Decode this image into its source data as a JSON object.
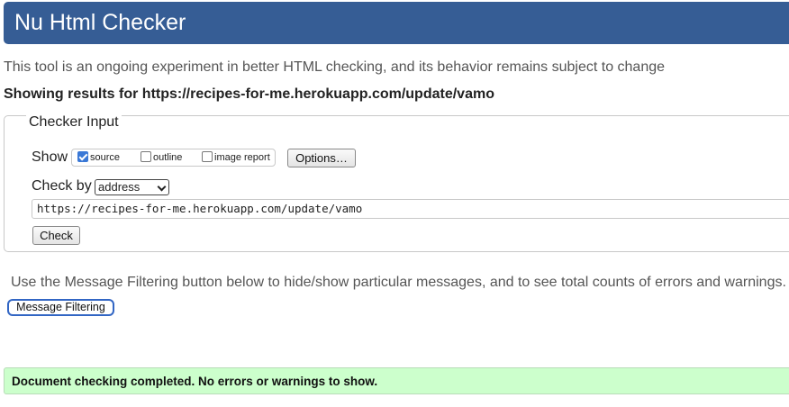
{
  "header": {
    "title": "Nu Html Checker",
    "bg_color": "#365d95"
  },
  "intro_text": "This tool is an ongoing experiment in better HTML checking, and its behavior remains subject to change",
  "results_heading": "Showing results for https://recipes-for-me.herokuapp.com/update/vamo",
  "checker_input": {
    "legend": "Checker Input",
    "show_label": "Show",
    "options": [
      {
        "label": "source",
        "checked": true
      },
      {
        "label": "outline",
        "checked": false
      },
      {
        "label": "image report",
        "checked": false
      }
    ],
    "options_button": "Options…",
    "check_by_label": "Check by",
    "check_by_value": "address",
    "url_value": "https://recipes-for-me.herokuapp.com/update/vamo",
    "check_button": "Check"
  },
  "filtering": {
    "text": "Use the Message Filtering button below to hide/show particular messages, and to see total counts of errors and warnings.",
    "button": "Message Filtering"
  },
  "result_message": {
    "text": "Document checking completed. No errors or warnings to show.",
    "bg_color": "#ccffcc"
  }
}
